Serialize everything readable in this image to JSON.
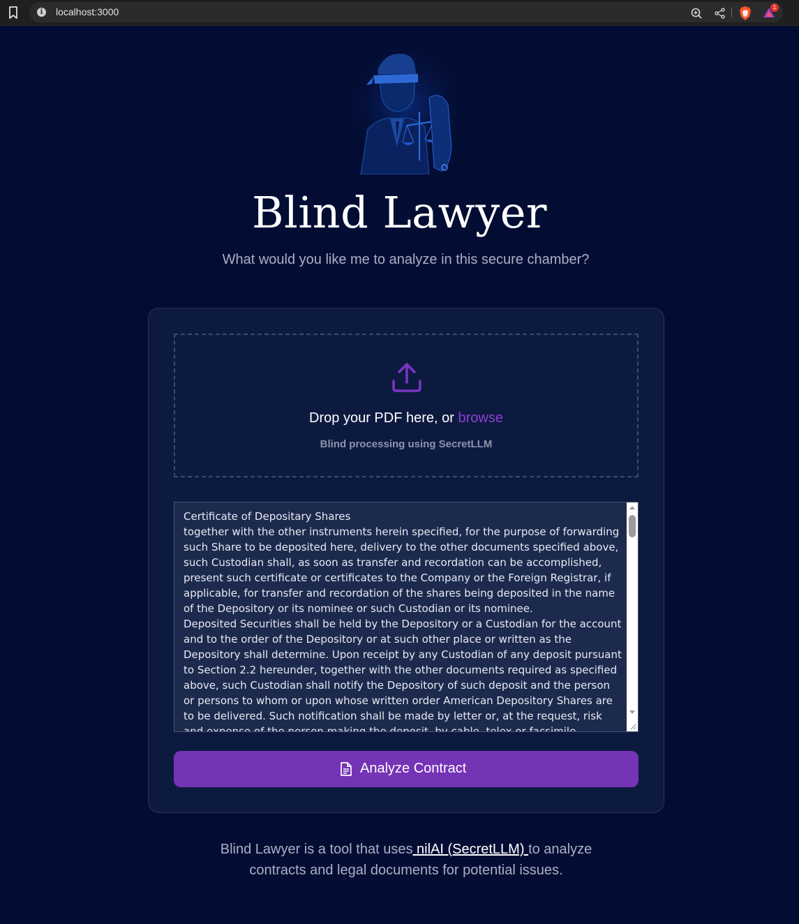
{
  "browser": {
    "url": "localhost:3000",
    "notification_count": "1",
    "icons": [
      "bookmark-icon",
      "site-info-icon",
      "zoom-icon",
      "share-icon",
      "brave-shields-icon",
      "brave-rewards-icon"
    ]
  },
  "hero": {
    "title": "Blind Lawyer",
    "subtitle": "What would you like me to analyze in this secure chamber?"
  },
  "upload": {
    "prompt_prefix": "Drop your PDF here, or ",
    "browse_label": "browse",
    "hint": "Blind processing using SecretLLM"
  },
  "contract_text": "Certificate of Depositary Shares\ntogether with the other instruments herein specified, for the purpose of forwarding such Share to be deposited here, delivery to the other documents specified above, such Custodian shall, as soon as transfer and recordation can be accomplished, present such certificate or certificates to the Company or the Foreign Registrar, if applicable, for transfer and recordation of the shares being deposited in the name of the Depository or its nominee or such Custodian or its nominee.\nDeposited Securities shall be held by the Depository or a Custodian for the account and to the order of the Depository or at such other place or written as the Depository shall determine. Upon receipt by any Custodian of any deposit pursuant to Section 2.2 hereunder, together with the other documents required as specified above, such Custodian shall notify the Depository of such deposit and the person or persons to whom or upon whose written order American Depository Shares are to be delivered. Such notification shall be made by letter or, at the request, risk and expense of the person making the deposit, by cable, telex or facsimile transmission (and in addition",
  "action": {
    "analyze_label": "Analyze Contract"
  },
  "footer": {
    "prefix": "Blind Lawyer is a tool that uses",
    "link_text": " nilAI (SecretLLM) ",
    "suffix": "to analyze contracts and legal documents for potential issues."
  },
  "colors": {
    "background": "#030d33",
    "card": "#0d1a40",
    "accent": "#7533b5",
    "browse": "#8b3fd1"
  }
}
